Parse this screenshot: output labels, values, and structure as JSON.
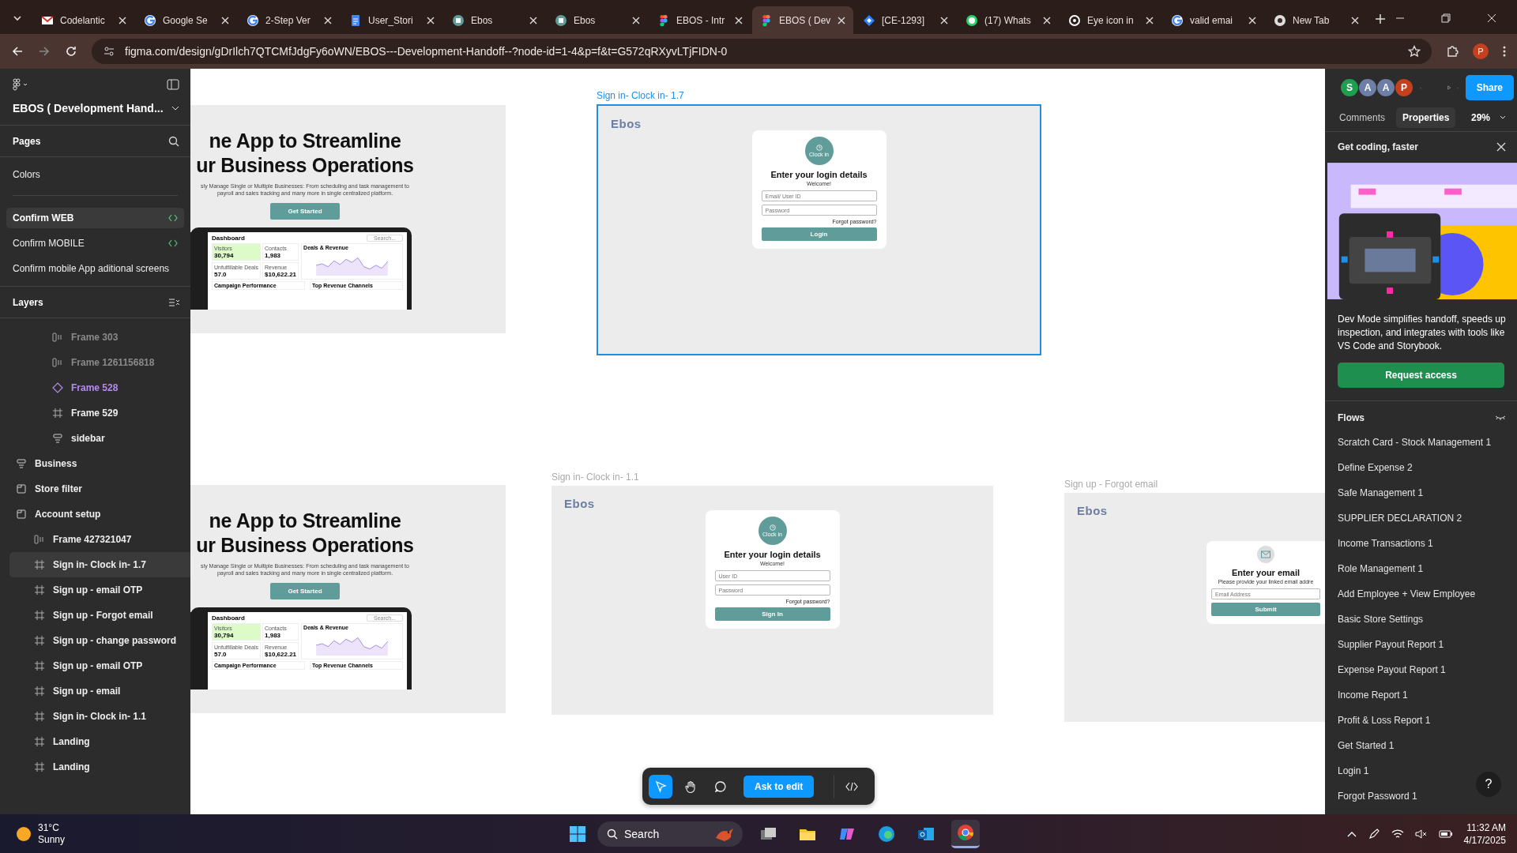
{
  "browser": {
    "tabs": [
      {
        "kind": "mail",
        "title": "Codelantic",
        "selected": false
      },
      {
        "kind": "google",
        "title": "Google Se",
        "selected": false
      },
      {
        "kind": "google",
        "title": "2-Step Ver",
        "selected": false
      },
      {
        "kind": "doc",
        "title": "User_Stori",
        "selected": false
      },
      {
        "kind": "app",
        "title": "Ebos",
        "selected": false
      },
      {
        "kind": "app",
        "title": "Ebos",
        "selected": false
      },
      {
        "kind": "figma",
        "title": "EBOS - Intr",
        "selected": false
      },
      {
        "kind": "figma",
        "title": "EBOS ( Dev",
        "selected": true
      },
      {
        "kind": "jira",
        "title": "[CE-1293]",
        "selected": false
      },
      {
        "kind": "chat",
        "title": "(17) Whats",
        "selected": false
      },
      {
        "kind": "ring",
        "title": "Eye icon in",
        "selected": false
      },
      {
        "kind": "google",
        "title": "valid emai",
        "selected": false
      },
      {
        "kind": "newtab",
        "title": "New Tab",
        "selected": false
      }
    ],
    "url": "figma.com/design/gDrIlch7QTCMfJdgFy6oWN/EBOS---Development-Handoff--?node-id=1-4&p=f&t=G572qRXyvLTjFIDN-0",
    "profile": "P"
  },
  "left_panel": {
    "file_name": "EBOS ( Development Hand...",
    "pages_title": "Pages",
    "pages": [
      {
        "label": "Colors",
        "selected": false,
        "dev": false
      },
      {
        "label": "Confirm WEB",
        "selected": true,
        "dev": true
      },
      {
        "label": "Confirm  MOBILE",
        "selected": false,
        "dev": true
      },
      {
        "label": "Confirm mobile App aditional screens",
        "selected": false,
        "dev": false
      }
    ],
    "layers_title": "Layers",
    "layers": [
      {
        "children": [
          {
            "kind": "autolayout",
            "label": "Frame 303",
            "hidden": true,
            "selected": false
          },
          {
            "kind": "autolayout",
            "label": "Frame 1261156818",
            "hidden": true,
            "selected": false
          },
          {
            "kind": "component",
            "label": "Frame 528",
            "hidden": false,
            "selected": false
          },
          {
            "kind": "frame",
            "label": "Frame 529",
            "hidden": false,
            "selected": false
          },
          {
            "kind": "group",
            "label": "sidebar",
            "hidden": false,
            "selected": false
          }
        ]
      },
      {
        "kind": "group",
        "label": "Business",
        "hidden": false,
        "selected": false
      },
      {
        "kind": "section",
        "label": "Store filter",
        "hidden": false,
        "selected": false
      },
      {
        "kind": "section",
        "label": "Account setup",
        "hidden": false,
        "selected": false,
        "children": [
          {
            "kind": "autolayout",
            "label": "Frame 427321047",
            "hidden": false,
            "selected": false
          },
          {
            "kind": "frame",
            "label": "Sign in- Clock in- 1.7",
            "hidden": false,
            "selected": true
          },
          {
            "kind": "frame",
            "label": "Sign up - email OTP",
            "hidden": false,
            "selected": false
          },
          {
            "kind": "frame",
            "label": "Sign up - Forgot email",
            "hidden": false,
            "selected": false
          },
          {
            "kind": "frame",
            "label": "Sign up - change password",
            "hidden": false,
            "selected": false
          },
          {
            "kind": "frame",
            "label": "Sign up - email OTP",
            "hidden": false,
            "selected": false
          },
          {
            "kind": "frame",
            "label": "Sign up - email",
            "hidden": false,
            "selected": false
          },
          {
            "kind": "frame",
            "label": "Sign in- Clock in- 1.1",
            "hidden": false,
            "selected": false
          },
          {
            "kind": "frame",
            "label": "Landing",
            "hidden": false,
            "selected": false
          },
          {
            "kind": "frame",
            "label": "Landing",
            "hidden": false,
            "selected": false
          }
        ]
      }
    ]
  },
  "canvas": {
    "frames": [
      {
        "kind": "landing",
        "selected": false,
        "headline": [
          "ne App to Streamline",
          "ur Business Operations"
        ],
        "subtitle": [
          "sly Manage Single or Multiple Businesses: From scheduling and task management to",
          "payroll and sales tracking and many more in single centralized platform."
        ],
        "button": "Get Started",
        "dashboard": {
          "title": "Dashboard",
          "search": "Search...",
          "stats": [
            {
              "label": "Visitors",
              "value": "30,794",
              "highlight": true
            },
            {
              "label": "Contacts",
              "value": "1,983",
              "highlight": false
            },
            {
              "label": "Unfulfillable Deals",
              "value": "57.0",
              "highlight": false
            },
            {
              "label": "Revenue",
              "value": "$10,622.21",
              "highlight": false
            }
          ],
          "chart_title": "Deals & Revenue",
          "panels": [
            "Campaign Performance",
            "Top Revenue Channels"
          ]
        }
      },
      {
        "kind": "signin",
        "label": "Sign in- Clock in- 1.7",
        "selected": true,
        "logo": "Ebos",
        "badge": "Clock in",
        "title": "Enter your login details",
        "subtitle": "Welcome!",
        "fields": [
          {
            "placeholder": "Email/ User ID"
          },
          {
            "placeholder": "Password"
          }
        ],
        "link": "Forgot password?",
        "button": "Login"
      },
      {
        "kind": "landing",
        "selected": false,
        "headline": [
          "ne App to Streamline",
          "ur Business Operations"
        ],
        "subtitle": [
          "sly Manage Single or Multiple Businesses: From scheduling and task management to",
          "payroll and sales tracking and many more in single centralized platform."
        ],
        "button": "Get Started",
        "dashboard": {
          "title": "Dashboard",
          "search": "Search...",
          "stats": [
            {
              "label": "Visitors",
              "value": "30,794",
              "highlight": true
            },
            {
              "label": "Contacts",
              "value": "1,983",
              "highlight": false
            },
            {
              "label": "Unfulfillable Deals",
              "value": "57.0",
              "highlight": false
            },
            {
              "label": "Revenue",
              "value": "$10,622.21",
              "highlight": false
            }
          ],
          "chart_title": "Deals & Revenue",
          "panels": [
            "Campaign Performance",
            "Top Revenue Channels"
          ]
        }
      },
      {
        "kind": "signin",
        "label": "Sign in- Clock in- 1.1",
        "selected": false,
        "logo": "Ebos",
        "badge": "Clock in",
        "title": "Enter your login details",
        "subtitle": "Welcome!",
        "fields": [
          {
            "placeholder": "User ID"
          },
          {
            "placeholder": "Password"
          }
        ],
        "link": "Forgot password?",
        "button": "Sign In"
      },
      {
        "kind": "email",
        "label": "Sign up - Forgot email",
        "selected": false,
        "logo": "Ebos",
        "title": "Enter your email",
        "subtitle": "Please provide your linked email addre",
        "fields": [
          {
            "placeholder": "Email Address"
          }
        ],
        "button": "Submit"
      }
    ],
    "toolbar": {
      "tools": [
        {
          "kind": "move",
          "selected": true
        },
        {
          "kind": "hand",
          "selected": false
        },
        {
          "kind": "comment",
          "selected": false
        }
      ],
      "ask": "Ask to edit",
      "dev_mode": false
    }
  },
  "right_panel": {
    "avatars": [
      {
        "letter": "S",
        "color": "#1e9e4e"
      },
      {
        "letter": "A",
        "color": "#6d7fa6"
      },
      {
        "letter": "A",
        "color": "#6d7fa6"
      },
      {
        "letter": "P",
        "color": "#c4401f"
      }
    ],
    "share": "Share",
    "tabs": [
      {
        "label": "Comments",
        "selected": false
      },
      {
        "label": "Properties",
        "selected": true
      }
    ],
    "zoom": "29%",
    "promo": {
      "title": "Get coding, faster",
      "text": "Dev Mode simplifies handoff, speeds up inspection, and integrates with tools like VS Code and Storybook.",
      "button": "Request access"
    },
    "flows_title": "Flows",
    "flows": [
      "Scratch Card - Stock Management 1",
      "Define Expense 2",
      "Safe Management 1",
      "SUPPLIER DECLARATION 2",
      "Income Transactions 1",
      "Role Management 1",
      "Add Employee + View Employee",
      "Basic Store Settings",
      "Supplier Payout Report 1",
      "Expense Payout Report 1",
      "Income Report 1",
      "Profit & Loss Report 1",
      "Get Started 1",
      "Login 1",
      "Forgot Password 1"
    ],
    "help": "?"
  },
  "taskbar": {
    "weather": {
      "temp": "31°C",
      "text": "Sunny"
    },
    "search": "Search",
    "apps": [
      {
        "kind": "files",
        "active": false
      },
      {
        "kind": "folder",
        "active": false
      },
      {
        "kind": "copilot",
        "active": false
      },
      {
        "kind": "edge",
        "active": false
      },
      {
        "kind": "outlook",
        "active": false
      },
      {
        "kind": "chrome",
        "active": true
      }
    ],
    "time": "11:32 AM",
    "date": "4/17/2025"
  }
}
